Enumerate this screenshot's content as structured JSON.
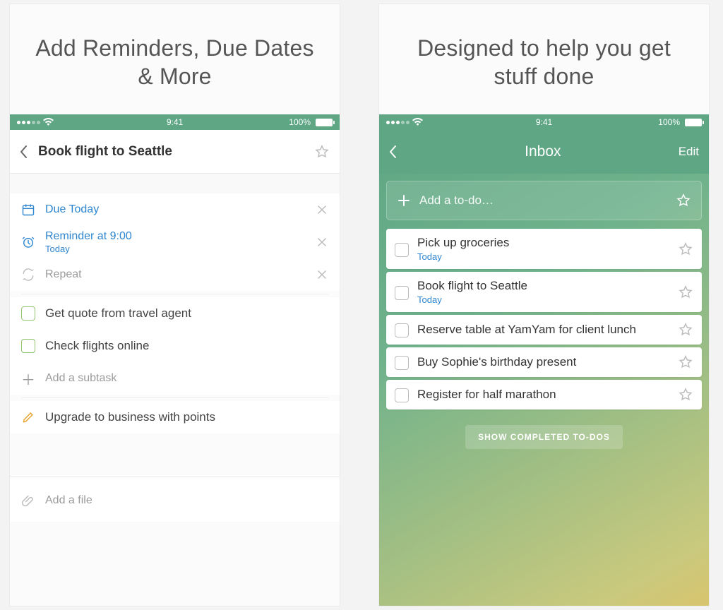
{
  "screenA": {
    "heading": "Add Reminders, Due Dates & More",
    "status": {
      "time": "9:41",
      "batteryText": "100%"
    },
    "title": "Book flight to Seattle",
    "due": {
      "label": "Due Today"
    },
    "reminder": {
      "label": "Reminder at 9:00",
      "sub": "Today"
    },
    "repeat": {
      "label": "Repeat"
    },
    "subtasks": [
      {
        "label": "Get quote from travel agent"
      },
      {
        "label": "Check flights online"
      }
    ],
    "addSubtask": "Add a subtask",
    "notePlaceholder": "Upgrade to business with points",
    "addFile": "Add a file"
  },
  "screenB": {
    "heading": "Designed to help you get stuff done",
    "status": {
      "time": "9:41",
      "batteryText": "100%"
    },
    "title": "Inbox",
    "edit": "Edit",
    "addPlaceholder": "Add a to-do…",
    "todos": [
      {
        "title": "Pick up groceries",
        "sub": "Today"
      },
      {
        "title": "Book flight to Seattle",
        "sub": "Today"
      },
      {
        "title": "Reserve table at YamYam for client lunch",
        "sub": ""
      },
      {
        "title": "Buy Sophie's birthday present",
        "sub": ""
      },
      {
        "title": "Register for half marathon",
        "sub": ""
      }
    ],
    "completed": "SHOW COMPLETED TO-DOS"
  }
}
